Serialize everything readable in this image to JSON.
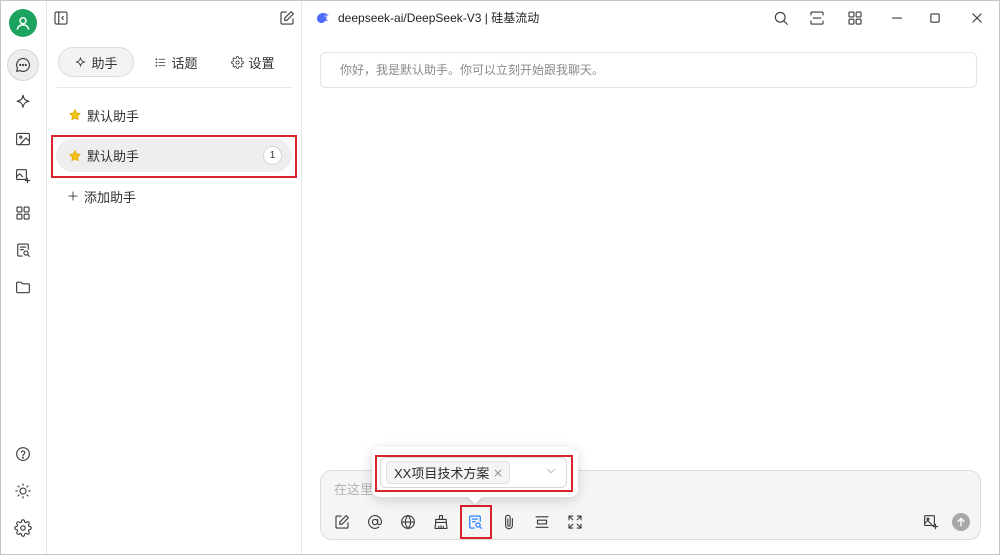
{
  "window": {
    "title": "deepseek-ai/DeepSeek-V3 | 硅基流动",
    "model_logo_icon": "deepseek-whale-icon",
    "controls": [
      "search-icon",
      "fullscreen-toggle-icon",
      "layout-grid-icon",
      "minimize-icon",
      "maximize-icon",
      "close-icon"
    ]
  },
  "rail": {
    "avatar_icon": "user-icon",
    "items": [
      "chat-bubble-icon",
      "sparkle-icon",
      "image-icon",
      "image-translate-icon",
      "apps-grid-icon",
      "document-search-icon",
      "folder-icon"
    ],
    "active_item": "chat-bubble-icon",
    "bottom_items": [
      "help-icon",
      "sun-icon",
      "gear-icon"
    ]
  },
  "sidebar": {
    "toggle_icon": "sidebar-toggle-icon",
    "new_icon": "edit-icon",
    "tabs": [
      {
        "label": "助手",
        "icon": "sparkle-icon",
        "active": true
      },
      {
        "label": "话题",
        "icon": "list-icon",
        "active": false
      },
      {
        "label": "设置",
        "icon": "gear-icon",
        "active": false
      }
    ],
    "assistants": [
      {
        "name": "默认助手",
        "icon": "star-icon",
        "selected": false
      },
      {
        "name": "默认助手",
        "icon": "star-icon",
        "selected": true,
        "topic_count": "1"
      }
    ],
    "add_assistant_label": "添加助手"
  },
  "chat": {
    "messages": [
      {
        "text": "你好，我是默认助手。你可以立刻开始跟我聊天。"
      }
    ]
  },
  "composer": {
    "placeholder": "在这里",
    "toolbar_left": [
      "new-topic-icon",
      "mention-icon",
      "globe-icon",
      "clear-broom-icon",
      "knowledge-base-icon",
      "paperclip-icon",
      "expand-height-icon",
      "fullscreen-icon"
    ],
    "toolbar_right": [
      "image-plus-icon",
      "send-icon"
    ],
    "active_tool": "knowledge-base-icon",
    "knowledge_select": {
      "selected": [
        "XX项目技术方案"
      ]
    }
  },
  "colors": {
    "accent": "#1677ff",
    "annotation": "#d9232d",
    "avatar": "#1ba35f",
    "deepseek_logo": "#4d6bfe",
    "star": "#f5c518",
    "selected_bg": "#eeeeee"
  }
}
